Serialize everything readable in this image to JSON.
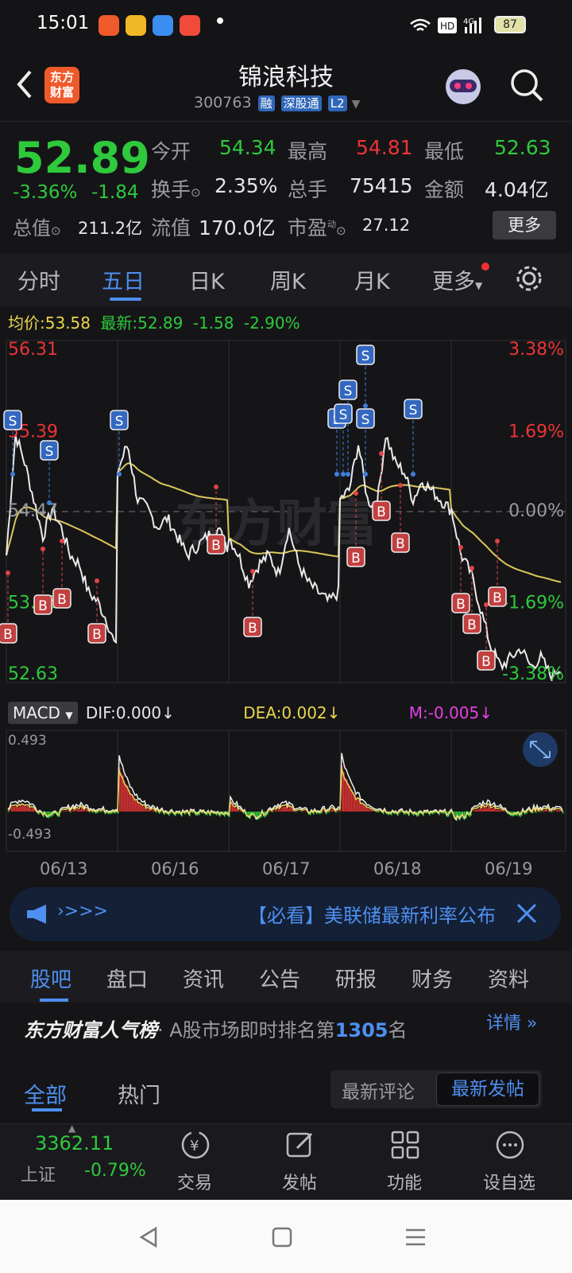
{
  "status": {
    "time": "15:01",
    "battery": "87"
  },
  "header": {
    "logo_line1": "东方",
    "logo_line2": "财富",
    "title": "锦浪科技",
    "code": "300763",
    "tag1": "融",
    "tag2": "深股通",
    "tag3": "L2"
  },
  "quote": {
    "price": "52.89",
    "change_pct": "-3.36%",
    "change": "-1.84",
    "open_label": "今开",
    "open": "54.34",
    "high_label": "最高",
    "high": "54.81",
    "low_label": "最低",
    "low": "52.63",
    "turnover_label": "换手",
    "turnover": "2.35%",
    "volume_label": "总手",
    "volume": "75415",
    "amount_label": "金额",
    "amount": "4.04亿",
    "mktcap_label": "总值",
    "mktcap": "211.2亿",
    "float_label": "流值",
    "float": "170.0亿",
    "pe_label": "市盈",
    "pe_sup": "动",
    "pe": "27.12",
    "more": "更多"
  },
  "tabs": [
    "分时",
    "五日",
    "日K",
    "周K",
    "月K",
    "更多"
  ],
  "avgline": {
    "avg_label": "均价:",
    "avg": "53.58",
    "last_label": "最新:",
    "last": "52.89",
    "chg": "-1.58",
    "pct": "-2.90%"
  },
  "chart_data": {
    "type": "line",
    "y_labels_left": [
      "56.31",
      "55.39",
      "54.47",
      "53.55",
      "52.63"
    ],
    "y_labels_right": [
      "3.38%",
      "1.69%",
      "0.00%",
      "-1.69%",
      "-3.38%"
    ],
    "x": [
      "06/13",
      "06/16",
      "06/17",
      "06/18",
      "06/19"
    ],
    "ylim": [
      52.63,
      56.31
    ],
    "watermark": "东方财富"
  },
  "macd": {
    "label": "MACD",
    "dif": "DIF:0.000",
    "dea": "DEA:0.002",
    "m": "M:-0.005",
    "top": "0.493",
    "bottom": "-0.493"
  },
  "banner": {
    "prefix": "›>>>",
    "text": "【必看】美联储最新利率公布"
  },
  "subtabs": [
    "股吧",
    "盘口",
    "资讯",
    "公告",
    "研报",
    "财务",
    "资料"
  ],
  "rank": {
    "brand": "东方财富人气榜",
    "text": "· A股市场即时排名第",
    "num": "1305",
    "suffix": "名",
    "detail": "详情"
  },
  "section": {
    "all": "全部",
    "hot": "热门",
    "latest_comment": "最新评论",
    "latest_post": "最新发帖"
  },
  "bottom": {
    "index": "3362.11",
    "index_name": "上证",
    "index_pct": "-0.79%",
    "trade": "交易",
    "post": "发帖",
    "func": "功能",
    "watch": "设自选"
  }
}
